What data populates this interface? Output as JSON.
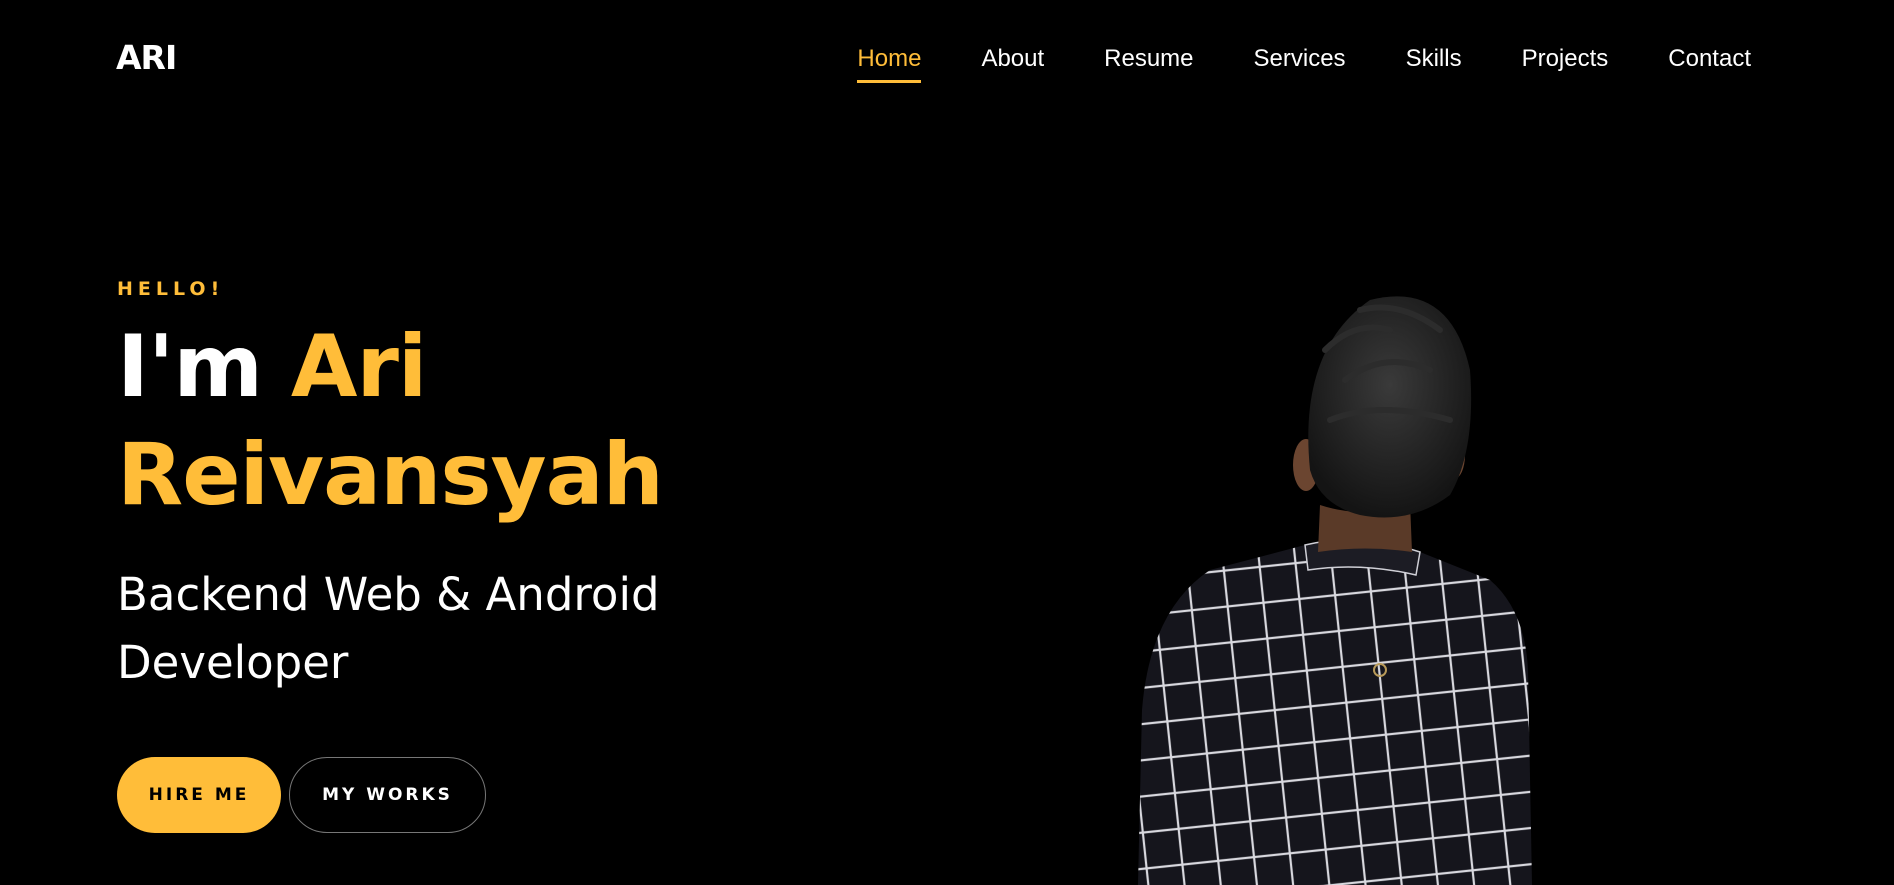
{
  "header": {
    "logo": "ARI"
  },
  "nav": {
    "items": [
      {
        "label": "Home",
        "active": true
      },
      {
        "label": "About",
        "active": false
      },
      {
        "label": "Resume",
        "active": false
      },
      {
        "label": "Services",
        "active": false
      },
      {
        "label": "Skills",
        "active": false
      },
      {
        "label": "Projects",
        "active": false
      },
      {
        "label": "Contact",
        "active": false
      }
    ]
  },
  "hero": {
    "subheading": "HELLO!",
    "greeting": "I'm",
    "name_first": "Ari",
    "name_last": "Reivansyah",
    "role": "Backend Web & Android Developer",
    "buttons": {
      "hire_label": "HIRE ME",
      "works_label": "MY WORKS"
    },
    "photo_icon": "person-portrait-icon"
  },
  "colors": {
    "accent": "#ffbd39",
    "background": "#000000",
    "text": "#ffffff"
  }
}
